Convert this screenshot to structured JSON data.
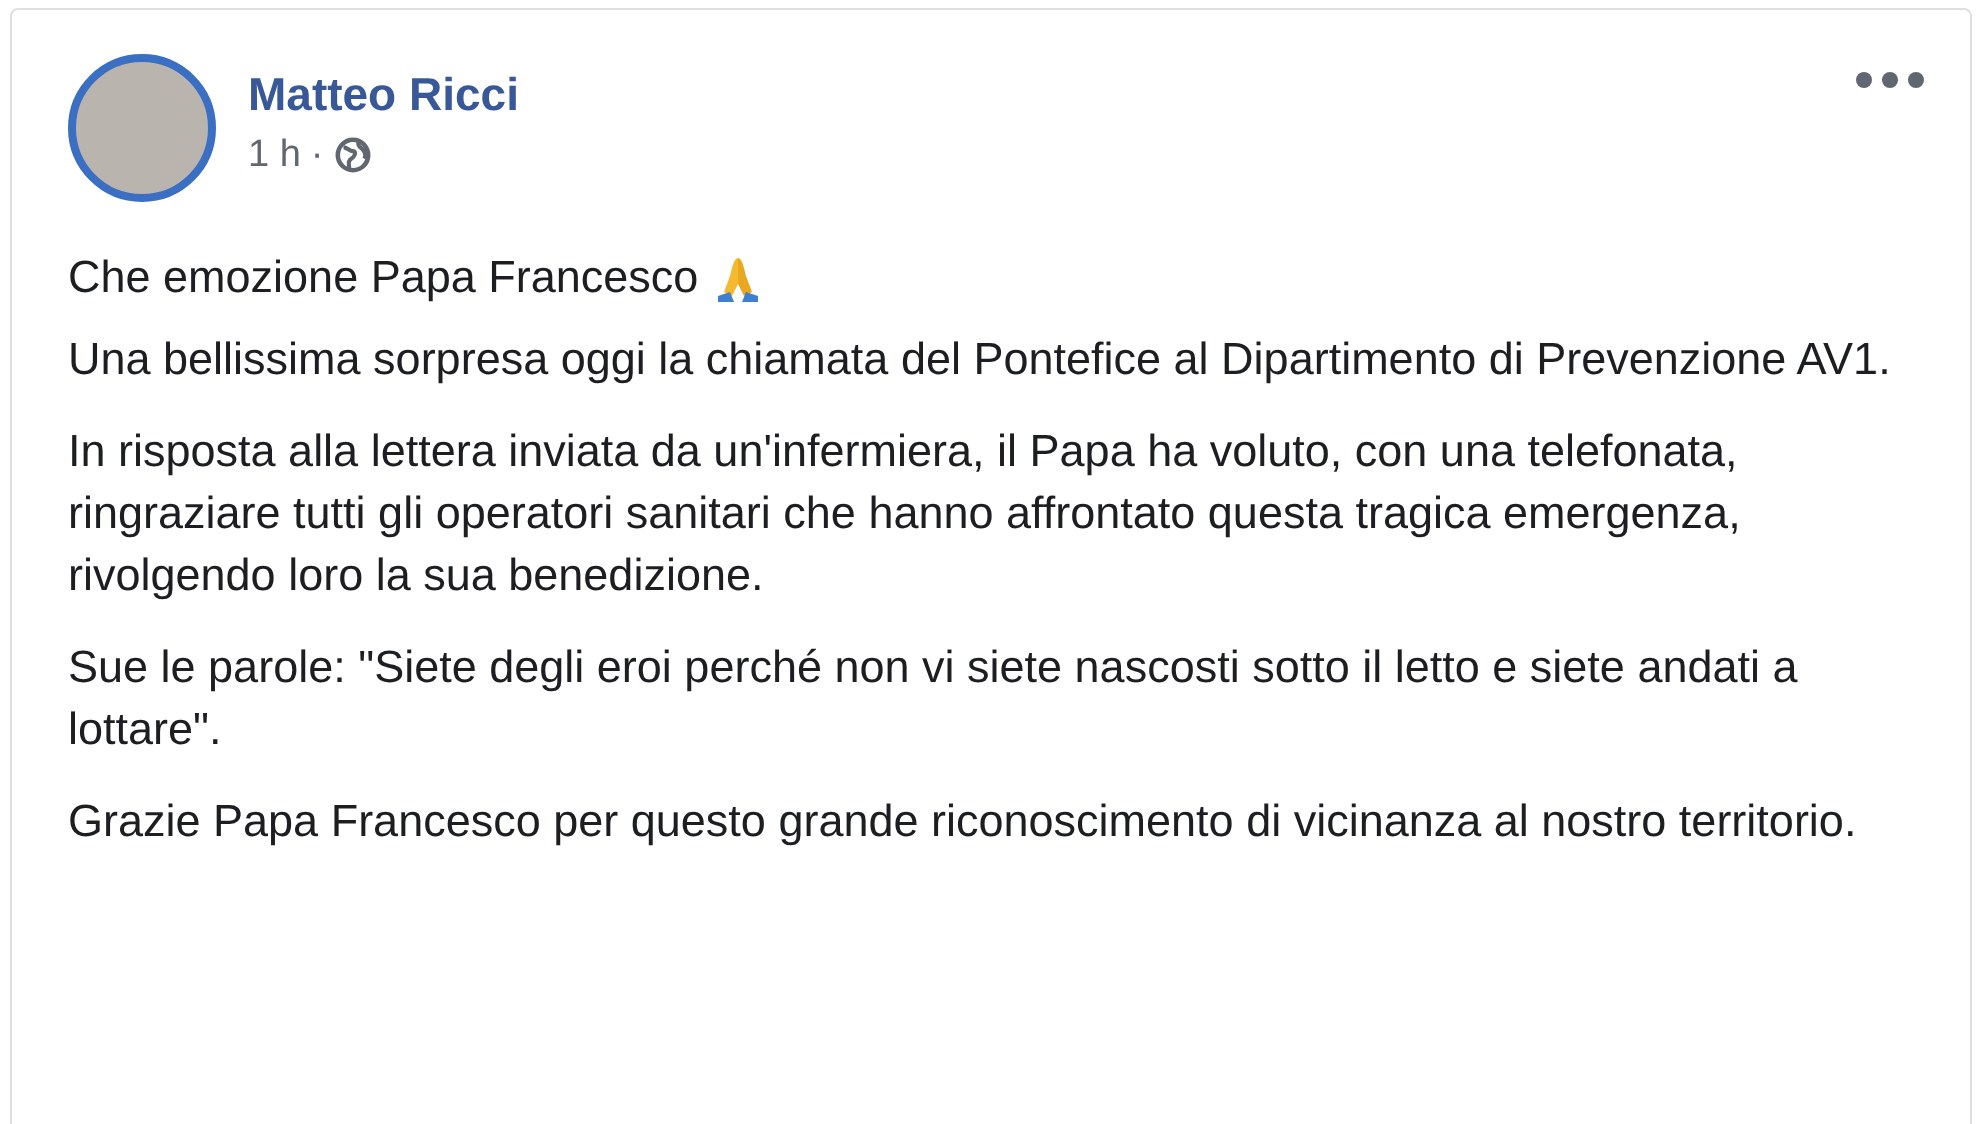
{
  "post": {
    "author": "Matteo Ricci",
    "time": "1 h",
    "separator": "·",
    "paragraphs": [
      "Che emozione Papa Francesco",
      "Una bellissima sorpresa oggi la chiamata del Pontefice al Dipartimento di Prevenzione AV1.",
      "In risposta alla lettera inviata da un'infermiera, il Papa ha voluto, con una telefonata, ringraziare tutti gli operatori sanitari che hanno affrontato questa tragica emergenza, rivolgendo loro la sua benedizione.",
      "Sue le parole: \"Siete degli eroi perché non vi siete nascosti sotto il letto e siete andati a lottare\".",
      "Grazie Papa Francesco per questo grande riconoscimento di vicinanza al nostro territorio."
    ]
  }
}
